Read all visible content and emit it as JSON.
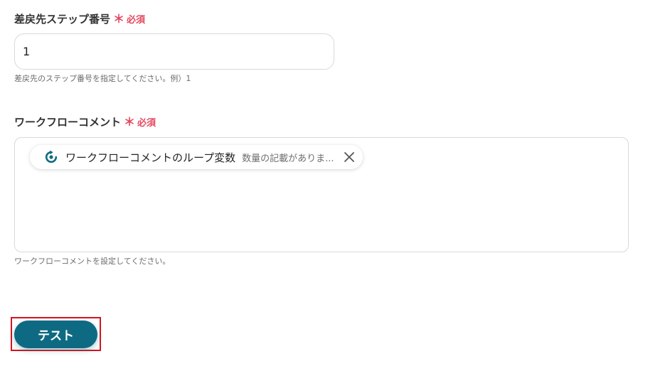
{
  "step_field": {
    "label": "差戻先ステップ番号",
    "required_mark": "＊",
    "required_text": "必須",
    "value": "1",
    "help": "差戻先のステップ番号を指定してください。例）1"
  },
  "comment_field": {
    "label": "ワークフローコメント",
    "required_mark": "＊",
    "required_text": "必須",
    "chip": {
      "icon": "loop-refresh-icon",
      "name": "ワークフローコメントのループ変数",
      "preview": "数量の記載がありま..."
    },
    "help": "ワークフローコメントを設定してください。"
  },
  "actions": {
    "test_label": "テスト"
  },
  "colors": {
    "accent": "#0e6a82",
    "required": "#e4485f",
    "highlight": "#d6141e"
  }
}
